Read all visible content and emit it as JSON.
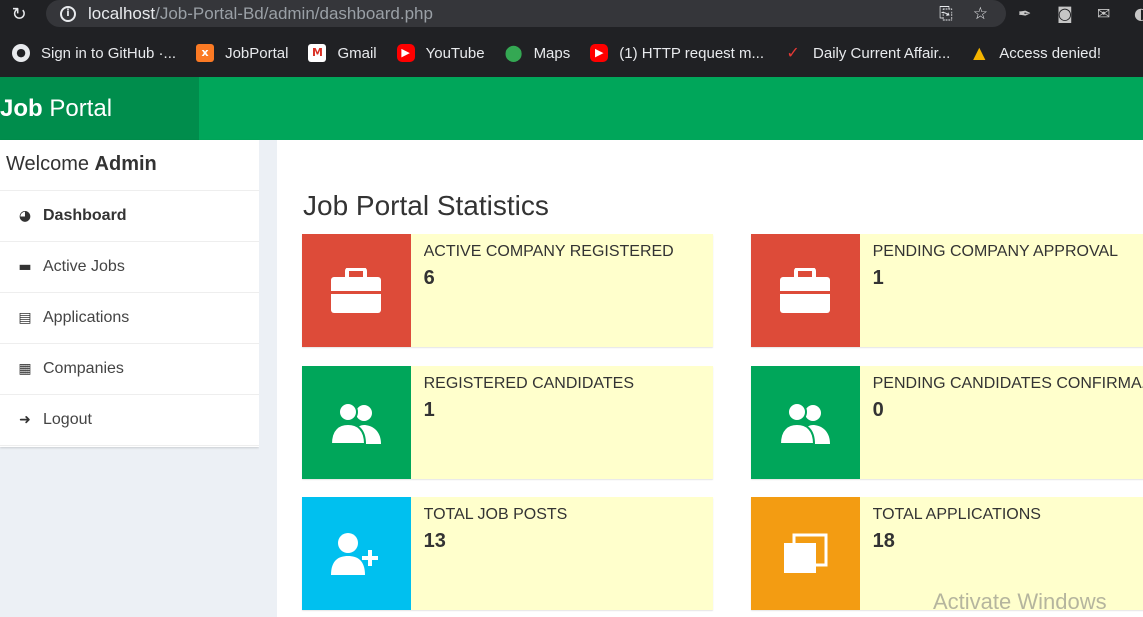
{
  "browser": {
    "url_host": "localhost",
    "url_path": "/Job-Portal-Bd/admin/dashboard.php",
    "bookmarks": [
      {
        "label": "Sign in to GitHub ·...",
        "icon": "github-icon"
      },
      {
        "label": "JobPortal",
        "icon": "xampp-icon"
      },
      {
        "label": "Gmail",
        "icon": "gmail-icon"
      },
      {
        "label": "YouTube",
        "icon": "youtube-icon"
      },
      {
        "label": "Maps",
        "icon": "maps-icon"
      },
      {
        "label": "(1) HTTP request m...",
        "icon": "youtube-icon"
      },
      {
        "label": "Daily Current Affair...",
        "icon": "news-icon"
      },
      {
        "label": "Access denied!",
        "icon": "site-icon"
      }
    ]
  },
  "header": {
    "logo_bold": "Job",
    "logo_rest": " Portal"
  },
  "sidebar": {
    "welcome_prefix": "Welcome ",
    "welcome_name": "Admin",
    "items": [
      {
        "label": "Dashboard",
        "icon": "dashboard-icon"
      },
      {
        "label": "Active Jobs",
        "icon": "briefcase-icon"
      },
      {
        "label": "Applications",
        "icon": "id-card-icon"
      },
      {
        "label": "Companies",
        "icon": "building-icon"
      },
      {
        "label": "Logout",
        "icon": "arrow-circle-icon"
      }
    ]
  },
  "main": {
    "title": "Job Portal Statistics",
    "stats": [
      {
        "label": "ACTIVE COMPANY REGISTERED",
        "value": "6",
        "color": "#dd4b39",
        "icon": "briefcase-icon"
      },
      {
        "label": "PENDING COMPANY APPROVAL",
        "value": "1",
        "color": "#dd4b39",
        "icon": "briefcase-icon"
      },
      {
        "label": "REGISTERED CANDIDATES",
        "value": "1",
        "color": "#00a65a",
        "icon": "users-icon"
      },
      {
        "label": "PENDING CANDIDATES CONFIRMATION",
        "value": "0",
        "color": "#00a65a",
        "icon": "users-icon"
      },
      {
        "label": "TOTAL JOB POSTS",
        "value": "13",
        "color": "#00c0ef",
        "icon": "user-plus-icon"
      },
      {
        "label": "TOTAL APPLICATIONS",
        "value": "18",
        "color": "#f39c12",
        "icon": "files-icon"
      }
    ]
  },
  "watermark": "Activate Windows"
}
